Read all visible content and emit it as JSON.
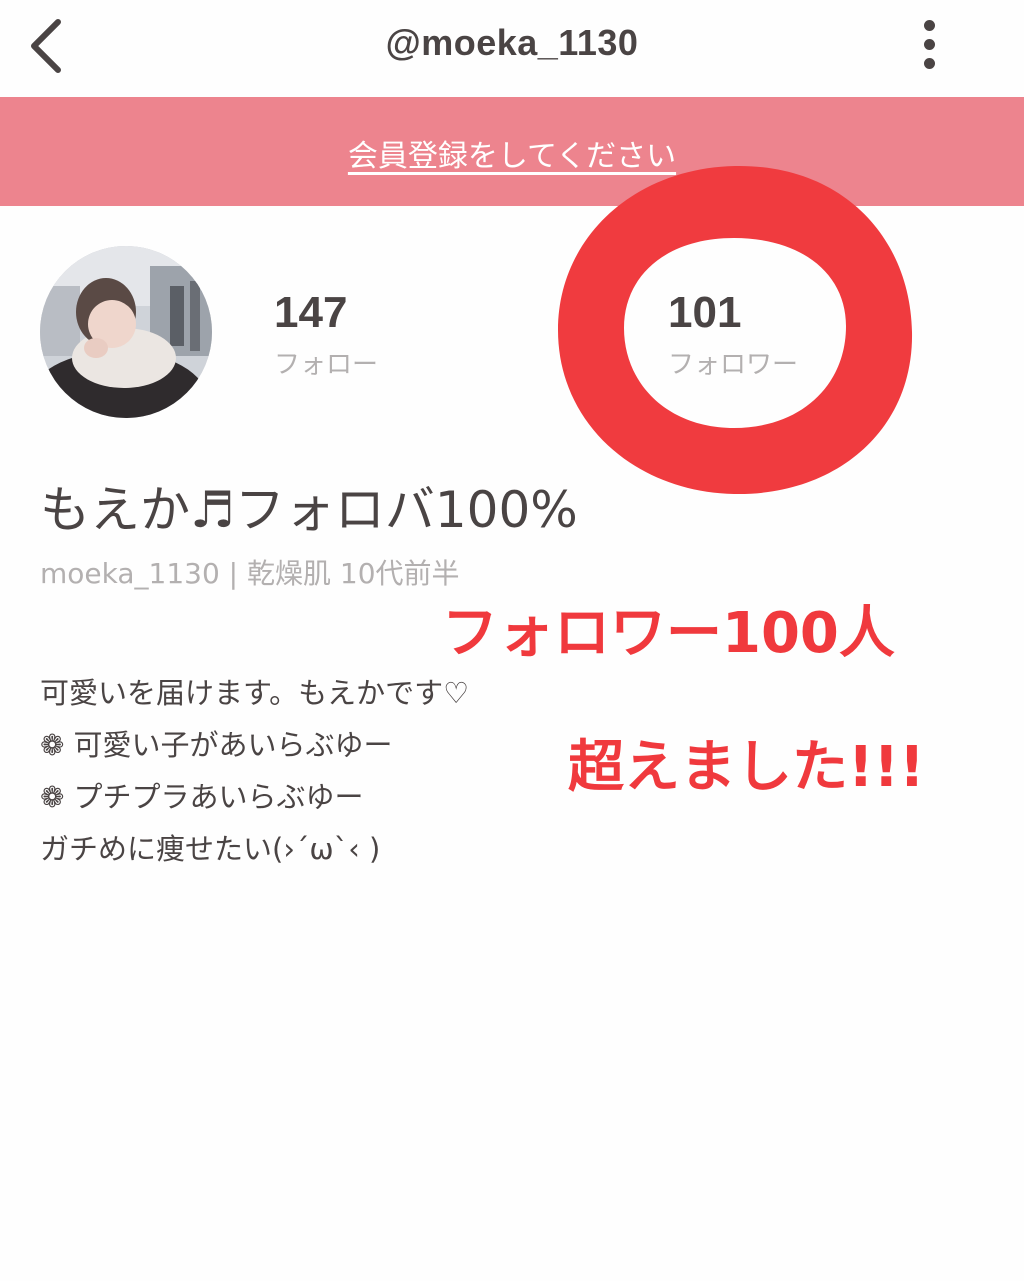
{
  "header": {
    "title": "@moeka_1130",
    "back_icon": "chevron-left-icon",
    "more_icon": "vertical-dots-icon"
  },
  "banner": {
    "text": "会員登録をしてください",
    "color": "#ed848e"
  },
  "profile": {
    "following_count": "147",
    "following_label": "フォロー",
    "followers_count": "101",
    "followers_label": "フォロワー",
    "display_name": "もえか♬フォロバ100%",
    "meta": "moeka_1130 | 乾燥肌  10代前半",
    "bio": [
      "可愛いを届けます。もえかです♡",
      "❁ 可愛い子があいらぶゆー",
      "❁ プチプラあいらぶゆー",
      "ガチめに痩せたい(›´ω`‹ )"
    ]
  },
  "annotation": {
    "line1": "フォロワー100人",
    "line2": "超えました!!!",
    "color": "#f0393d"
  }
}
